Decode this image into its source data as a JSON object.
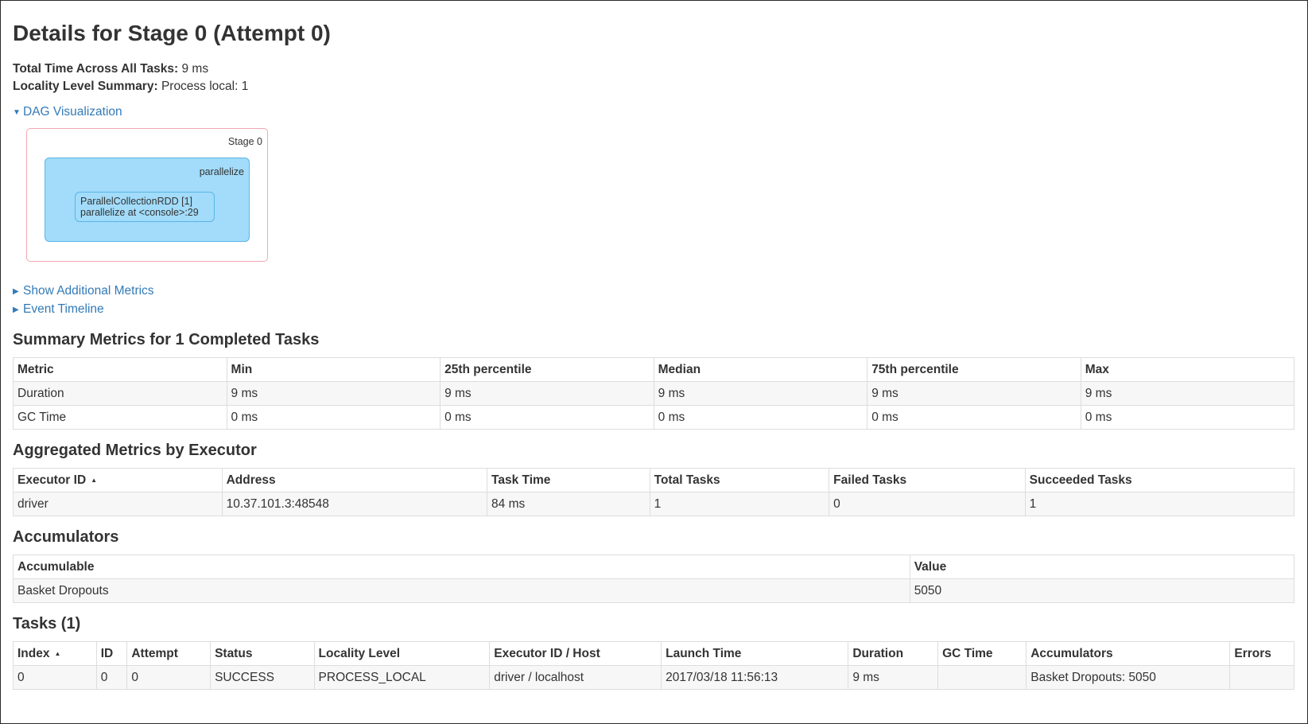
{
  "page": {
    "title": "Details for Stage 0 (Attempt 0)"
  },
  "summary": {
    "total_time_label": "Total Time Across All Tasks:",
    "total_time_value": "9 ms",
    "locality_label": "Locality Level Summary:",
    "locality_value": "Process local: 1"
  },
  "dag": {
    "link_label": "DAG Visualization",
    "stage_label": "Stage 0",
    "operation_label": "parallelize",
    "rdd_line1": "ParallelCollectionRDD [1]",
    "rdd_line2": "parallelize at <console>:29"
  },
  "expanders": {
    "additional_metrics": "Show Additional Metrics",
    "event_timeline": "Event Timeline"
  },
  "summary_metrics": {
    "heading": "Summary Metrics for 1 Completed Tasks",
    "headers": [
      "Metric",
      "Min",
      "25th percentile",
      "Median",
      "75th percentile",
      "Max"
    ],
    "rows": [
      [
        "Duration",
        "9 ms",
        "9 ms",
        "9 ms",
        "9 ms",
        "9 ms"
      ],
      [
        "GC Time",
        "0 ms",
        "0 ms",
        "0 ms",
        "0 ms",
        "0 ms"
      ]
    ]
  },
  "executors": {
    "heading": "Aggregated Metrics by Executor",
    "headers": [
      "Executor ID",
      "Address",
      "Task Time",
      "Total Tasks",
      "Failed Tasks",
      "Succeeded Tasks"
    ],
    "rows": [
      [
        "driver",
        "10.37.101.3:48548",
        "84 ms",
        "1",
        "0",
        "1"
      ]
    ]
  },
  "accumulators": {
    "heading": "Accumulators",
    "headers": [
      "Accumulable",
      "Value"
    ],
    "rows": [
      [
        "Basket Dropouts",
        "5050"
      ]
    ]
  },
  "tasks": {
    "heading": "Tasks (1)",
    "headers": [
      "Index",
      "ID",
      "Attempt",
      "Status",
      "Locality Level",
      "Executor ID / Host",
      "Launch Time",
      "Duration",
      "GC Time",
      "Accumulators",
      "Errors"
    ],
    "rows": [
      [
        "0",
        "0",
        "0",
        "SUCCESS",
        "PROCESS_LOCAL",
        "driver / localhost",
        "2017/03/18 11:56:13",
        "9 ms",
        "",
        "Basket Dropouts: 5050",
        ""
      ]
    ]
  }
}
